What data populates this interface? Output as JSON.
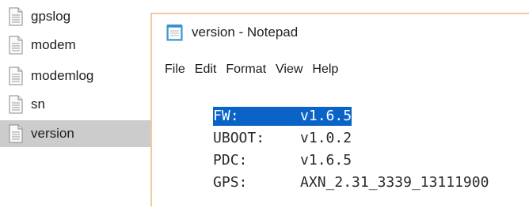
{
  "explorer": {
    "files": [
      {
        "name": "gpslog",
        "selected": false
      },
      {
        "name": "modem",
        "selected": false
      },
      {
        "name": "modemlog",
        "selected": false
      },
      {
        "name": "sn",
        "selected": false
      },
      {
        "name": "version",
        "selected": true
      }
    ],
    "icon": "text-document-icon"
  },
  "notepad": {
    "icon": "notepad-icon",
    "title": "version - Notepad",
    "menu": [
      "File",
      "Edit",
      "Format",
      "View",
      "Help"
    ],
    "lines": [
      {
        "key": "FW:",
        "value": "v1.6.5",
        "selected": true
      },
      {
        "key": "UBOOT:",
        "value": "v1.0.2",
        "selected": false
      },
      {
        "key": "PDC:",
        "value": "v1.6.5",
        "selected": false
      },
      {
        "key": "GPS:",
        "value": "AXN_2.31_3339_13111900",
        "selected": false
      }
    ],
    "selection_color": "#0a64c8"
  }
}
